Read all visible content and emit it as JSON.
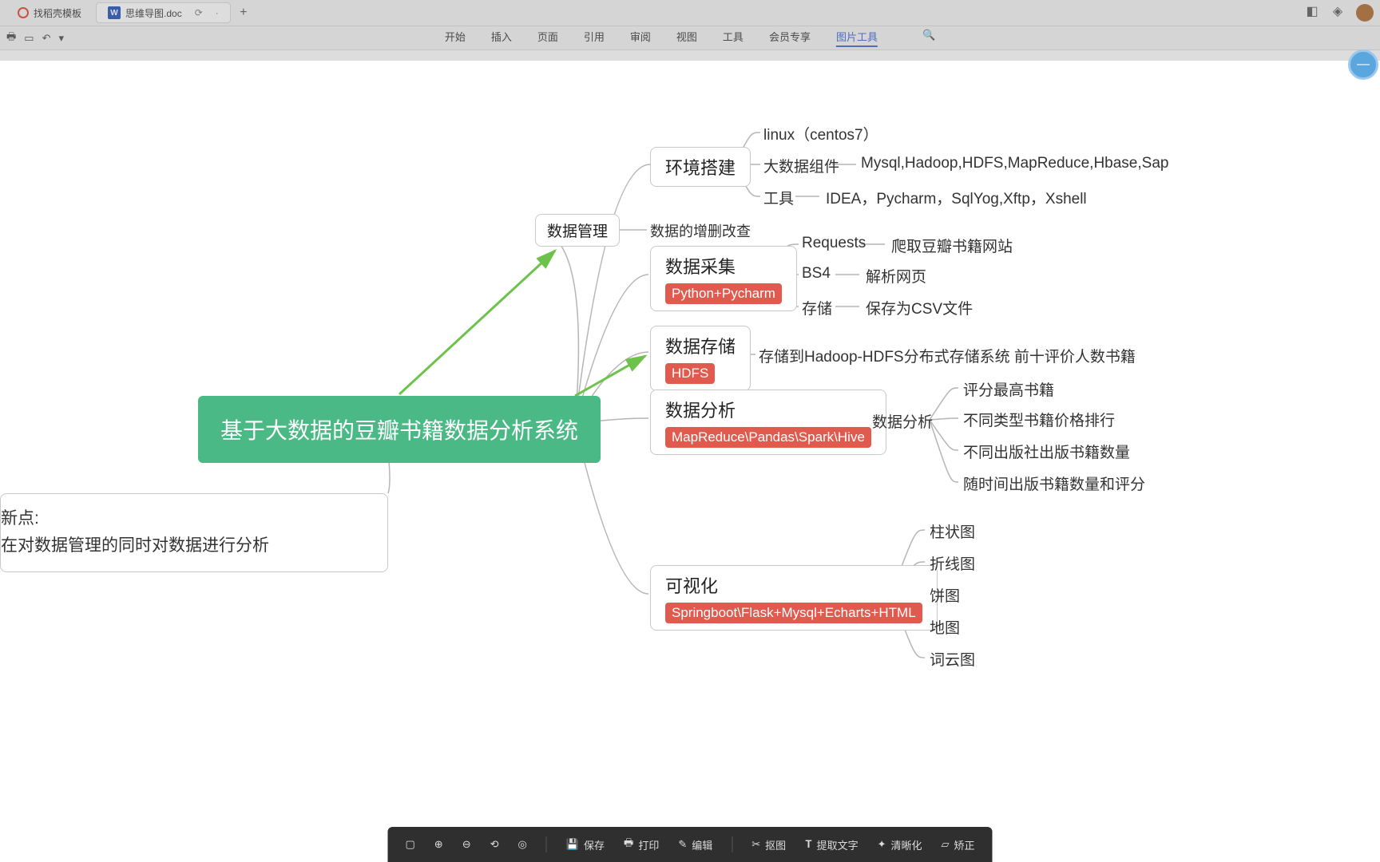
{
  "tabs": {
    "template_tab": "找稻壳模板",
    "doc_tab": "思维导图.doc",
    "doc_badge": "W"
  },
  "menu": {
    "items": [
      "开始",
      "插入",
      "页面",
      "引用",
      "审阅",
      "视图",
      "工具",
      "会员专享",
      "图片工具"
    ],
    "active_index": 8
  },
  "mindmap": {
    "root": "基于大数据的豆瓣书籍数据分析系统",
    "innovation": {
      "title": "新点:",
      "body": "在对数据管理的同时对数据进行分析"
    },
    "env": {
      "title": "环境搭建",
      "linux": "linux（centos7）",
      "bigdata_label": "大数据组件",
      "bigdata_val": "Mysql,Hadoop,HDFS,MapReduce,Hbase,Sap",
      "tool_label": "工具",
      "tool_val": "IDEA，Pycharm，SqlYog,Xftp，Xshell"
    },
    "mgmt": {
      "title": "数据管理",
      "crud": "数据的增删改查"
    },
    "collect": {
      "title": "数据采集",
      "badge": "Python+Pycharm",
      "req_label": "Requests",
      "req_val": "爬取豆瓣书籍网站",
      "bs4_label": "BS4",
      "bs4_val": "解析网页",
      "store_label": "存储",
      "store_val": "保存为CSV文件"
    },
    "storage": {
      "title": "数据存储",
      "badge": "HDFS",
      "val": "存储到Hadoop-HDFS分布式存储系统 前十评价人数书籍"
    },
    "analysis": {
      "title": "数据分析",
      "badge": "MapReduce\\Pandas\\Spark\\Hive",
      "sub_label": "数据分析",
      "items": [
        "评分最高书籍",
        "不同类型书籍价格排行",
        "不同出版社出版书籍数量",
        "随时间出版书籍数量和评分"
      ]
    },
    "viz": {
      "title": "可视化",
      "badge": "Springboot\\Flask+Mysql+Echarts+HTML",
      "items": [
        "柱状图",
        "折线图",
        "饼图",
        "地图",
        "词云图"
      ]
    }
  },
  "bottombar": {
    "save": "保存",
    "print": "打印",
    "edit": "编辑",
    "cutout": "抠图",
    "ocr": "提取文字",
    "enhance": "清晰化",
    "straighten": "矫正"
  }
}
